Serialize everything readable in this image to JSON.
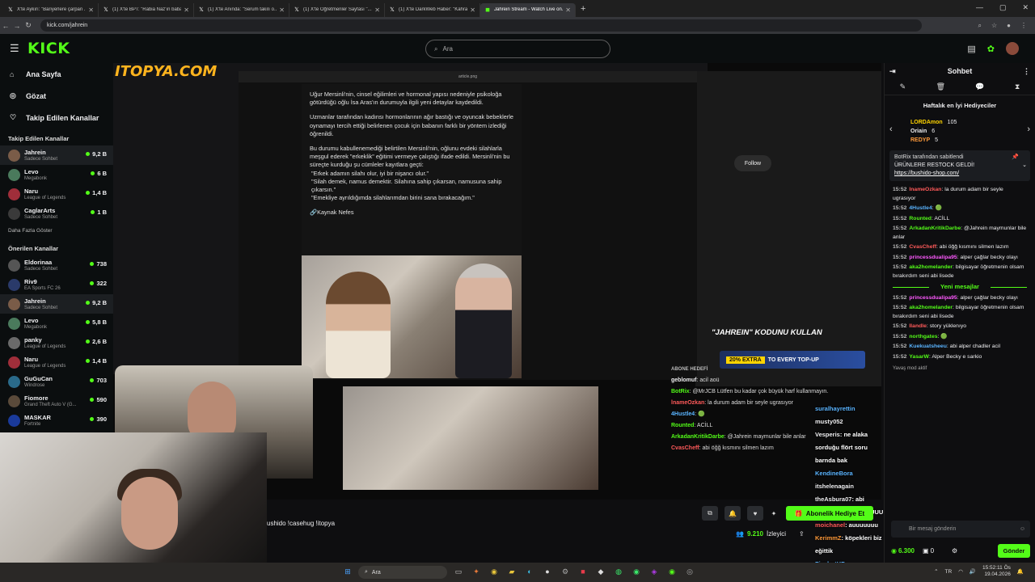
{
  "browser": {
    "tabs": [
      {
        "label": "X'te Aykırı: \"Bariyerlere çarpan ...",
        "active": false
      },
      {
        "label": "(1) X'te BPT: \"Rabia Naz'ın babası...",
        "active": false
      },
      {
        "label": "(1) X'te Anında: \"Serum takılı o...",
        "active": false
      },
      {
        "label": "(1) X'te Öğretmenler Sayfası \"...",
        "active": false
      },
      {
        "label": "(1) X'te DarkWeb Haber: \"Kahra...",
        "active": false
      },
      {
        "label": "Jahrein Stream - Watch Live on...",
        "active": true
      }
    ],
    "url": "kick.com/jahrein"
  },
  "kick": {
    "logo": "KICK",
    "search_placeholder": "Ara",
    "nav": [
      {
        "label": "Ana Sayfa",
        "icon": "home-icon"
      },
      {
        "label": "Gözat",
        "icon": "compass-icon"
      },
      {
        "label": "Takip Edilen Kanallar",
        "icon": "heart-icon"
      }
    ],
    "followed_title": "Takip Edilen Kanallar",
    "followed": [
      {
        "name": "Jahrein",
        "game": "Sadece Sohbet",
        "viewers": "9,2 B",
        "color": "#7a5c48",
        "selected": true
      },
      {
        "name": "Levo",
        "game": "Megabonk",
        "viewers": "6 B",
        "color": "#4a7a5c"
      },
      {
        "name": "Naru",
        "game": "League of Legends",
        "viewers": "1,4 B",
        "color": "#a02e3a"
      },
      {
        "name": "CaglarArts",
        "game": "Sadece Sohbet",
        "viewers": "1 B",
        "color": "#3a3a3a"
      }
    ],
    "show_more": "Daha Fazla Göster",
    "recommended_title": "Önerilen Kanallar",
    "recommended": [
      {
        "name": "Eldorinaa",
        "game": "Sadece Sohbet",
        "viewers": "738",
        "color": "#555"
      },
      {
        "name": "Riv9",
        "game": "EA Sports FC 26",
        "viewers": "322",
        "color": "#2a3a6a"
      },
      {
        "name": "Jahrein",
        "game": "Sadece Sohbet",
        "viewers": "9,2 B",
        "color": "#7a5c48",
        "selected": true
      },
      {
        "name": "Levo",
        "game": "Megabonk",
        "viewers": "5,8 B",
        "color": "#4a7a5c"
      },
      {
        "name": "panky",
        "game": "League of Legends",
        "viewers": "2,6 B",
        "color": "#6a6a6a"
      },
      {
        "name": "Naru",
        "game": "League of Legends",
        "viewers": "1,4 B",
        "color": "#a02e3a"
      },
      {
        "name": "GuGuCan",
        "game": "Windrose",
        "viewers": "703",
        "color": "#2a6a8a"
      },
      {
        "name": "Fiomore",
        "game": "Grand Theft Auto V (G...",
        "viewers": "590",
        "color": "#5a4a3a"
      },
      {
        "name": "MASKAR",
        "game": "Fortnite",
        "viewers": "390",
        "color": "#1a3a9a"
      }
    ]
  },
  "stream": {
    "watermark": "ITOPYA.COM",
    "viewer_title": "article.png",
    "article": [
      "Uğur Mersinli'nin, cinsel eğilimleri ve hormonal yapısı nedeniyle psikoloğa götürdüğü oğlu İsa Aras'ın durumuyla ilgili yeni detaylar kaydedildi.",
      "Uzmanlar tarafından kadınsı hormonlarının ağır bastığı ve oyuncak bebeklerle oynamayı tercih ettiği belirlenen çocuk için babanın farklı bir yöntem izlediği öğrenildi.",
      "Bu durumu kabullenemediği belirtilen Mersinli'nin, oğlunu evdeki silahlarla meşgul ederek \"erkeklik\" eğitimi vermeye çalıştığı ifade edildi. Mersinli'nin bu süreçte kurduğu şu cümleler kayıtlara geçti:"
    ],
    "quotes": [
      "\"Erkek adamın silahı olur, iyi bir nişancı olur.\"",
      "\"Silah demek, namus demektir. Silahına sahip çıkarsan, namusuna sahip çıkarsın.\"",
      "\"Emekliye ayrıldığımda silahlarımdan birini sana bırakacağım.\""
    ],
    "source": "🔗Kaynak Nefes",
    "follow_label": "Follow",
    "overlay_banner": "\"JAHREIN\" KODUNU KULLAN",
    "promo_extra": "20% EXTRA",
    "promo_text": "TO EVERY TOP-UP",
    "stream_title": "ushido !casehug !itopya",
    "viewers": "9.210",
    "viewers_label": "İzleyici",
    "gift_sub": "Abonelik Hediye Et",
    "onscreen_chat_header": "ABONE HEDEFİ",
    "onscreen_chat": [
      {
        "user": "geblomuf",
        "color": "#efeff1",
        "text": ": acil aoü"
      },
      {
        "user": "BotRix",
        "color": "#53fc18",
        "text": ": @MrJCB Lütfen bu kadar çok büyük harf kullanmayın."
      },
      {
        "user": "lnameOzkan",
        "color": "#ff5a5a",
        "text": ": la durum adam bir seyle ugrasıyor"
      },
      {
        "user": "4Hustle4",
        "color": "#5ab4ff",
        "text": ": 🟢"
      },
      {
        "user": "Rounted",
        "color": "#53fc18",
        "text": ": ACİLL"
      },
      {
        "user": "ArkadanKritikDarbe",
        "color": "#53fc18",
        "text": ": @Jahrein maymunlar bile anlar"
      },
      {
        "user": "CvasCheff",
        "color": "#ff5a5a",
        "text": ": abi öğğ kısmını silmen lazım"
      }
    ]
  },
  "overlay_chat": [
    {
      "user": "suralhayrettin",
      "color": "#5ab4ff"
    },
    {
      "user": "musty052",
      "color": "#efeff1"
    },
    {
      "user": "Vesperis",
      "color": "#efeff1",
      "text": ": ne alaka sorduğu flört soru barnda bak"
    },
    {
      "user": "KendineBora",
      "color": "#5ab4ff"
    },
    {
      "user": "itshelenagain",
      "color": "#efeff1"
    },
    {
      "user": "theAsbura07",
      "color": "#efeff1",
      "text": ": abi nerdeyiz suan AUUUUU"
    },
    {
      "user": "moichanel",
      "color": "#ff5a5a",
      "text": ": auuuuuuu"
    },
    {
      "user": "KerimmZ",
      "color": "#ff9a3a",
      "text": ": köpekleri biz eğittik"
    },
    {
      "user": "FixshotHD",
      "color": "#5ab4ff"
    }
  ],
  "chat": {
    "title": "Sohbet",
    "top_gifters_title": "Haftalık en İyi Hediyeciler",
    "gifters": [
      {
        "name": "LORDAmon",
        "count": "105",
        "color": "#ffd400"
      },
      {
        "name": "Oriain",
        "count": "6",
        "color": "#efeff1"
      },
      {
        "name": "REDYP",
        "count": "5",
        "color": "#ff9a3a"
      }
    ],
    "pinned_by": "BotRix tarafından sabitlendi",
    "pinned_text": "ÜRÜNLERE RESTOCK GELDİ!",
    "pinned_link": "https://bushido-shop.com/",
    "messages": [
      {
        "time": "15:52",
        "user": "lnameOzkan",
        "color": "#ff5a5a",
        "text": ": la durum adam bir seyle ugrasıyor"
      },
      {
        "time": "15:52",
        "user": "4Hustle4",
        "color": "#5ab4ff",
        "text": ": 🟢"
      },
      {
        "time": "15:52",
        "user": "Rounted",
        "color": "#53fc18",
        "text": ": ACİLL"
      },
      {
        "time": "15:52",
        "user": "ArkadanKritikDarbe",
        "color": "#53fc18",
        "text": ": @Jahrein maymunlar bile anlar"
      },
      {
        "time": "15:52",
        "user": "CvasCheff",
        "color": "#ff5a5a",
        "text": ": abi öğğ kısmını silmen lazım"
      },
      {
        "time": "15:52",
        "user": "princessdualipa95",
        "color": "#ff5aff",
        "text": ": alper çağlar becky olayı"
      },
      {
        "time": "15:52",
        "user": "aka2homelander",
        "color": "#53fc18",
        "text": ": bilgisayar öğretmenin olsam bırakırdım seni abi lisede"
      }
    ],
    "new_messages_label": "Yeni mesajlar",
    "new_messages": [
      {
        "time": "15:52",
        "user": "princessdualipa95",
        "color": "#ff5aff",
        "text": ": alper çağlar becky olayı"
      },
      {
        "time": "15:52",
        "user": "aka2homelander",
        "color": "#53fc18",
        "text": ": bilgisayar öğretmenin olsam bırakırdım seni abi lisede"
      },
      {
        "time": "15:52",
        "user": "Ilandle",
        "color": "#ff5a5a",
        "text": ": story yüklenıyo"
      },
      {
        "time": "15:52",
        "user": "northgates",
        "color": "#53fc18",
        "text": ": 🟢"
      },
      {
        "time": "15:52",
        "user": "Kuekuatsheeu",
        "color": "#5ab4ff",
        "text": ": abi alper chadler acil"
      },
      {
        "time": "15:52",
        "user": "YasarW",
        "color": "#53fc18",
        "text": ": Alper Becky e sarkio"
      }
    ],
    "mod_note": "Yavaş mod aktif",
    "input_placeholder": "Bir mesaj gönderin",
    "coins": "6.300",
    "subs": "0",
    "send_label": "Gönder"
  },
  "taskbar": {
    "search": "Ara",
    "time": "15:52:11 Ös",
    "date": "19.04.2026"
  }
}
